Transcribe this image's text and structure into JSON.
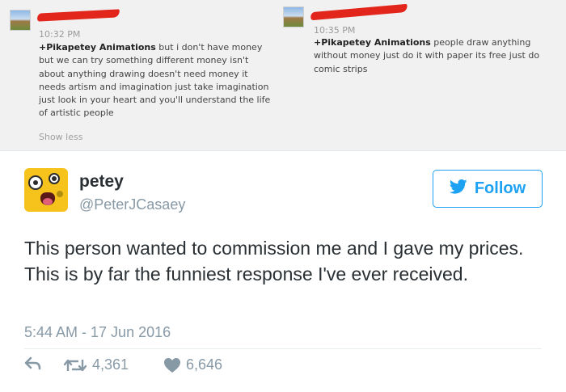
{
  "comments": [
    {
      "time": "10:32 PM",
      "mention": "+Pikapetey Animations",
      "text": " but i don't have money but we can try something different money isn't about anything drawing doesn't need money it needs artism and imagination just take imagination just look in your heart and you'll understand the life of artistic people",
      "toggle_label": "Show less"
    },
    {
      "time": "10:35 PM",
      "mention": "+Pikapetey Animations",
      "text": " people draw anything without money just do it with paper its free just do comic strips"
    }
  ],
  "tweet": {
    "display_name": "petey",
    "handle": "@PeterJCasaey",
    "follow_label": "Follow",
    "text": "This person wanted to commission me and I gave my prices.\nThis is by far the funniest response I've ever received.",
    "timestamp": "5:44 AM - 17 Jun 2016",
    "retweets": "4,361",
    "likes": "6,646",
    "icons": {
      "follow": "twitter-bird-icon",
      "reply": "reply-arrow-icon",
      "retweet": "retweet-icon",
      "like": "heart-icon"
    }
  },
  "colors": {
    "accent": "#1da1f2",
    "redaction": "#e3261b",
    "muted": "#8899a6",
    "text": "#292f33",
    "comment_bg": "#f1f1f1"
  }
}
